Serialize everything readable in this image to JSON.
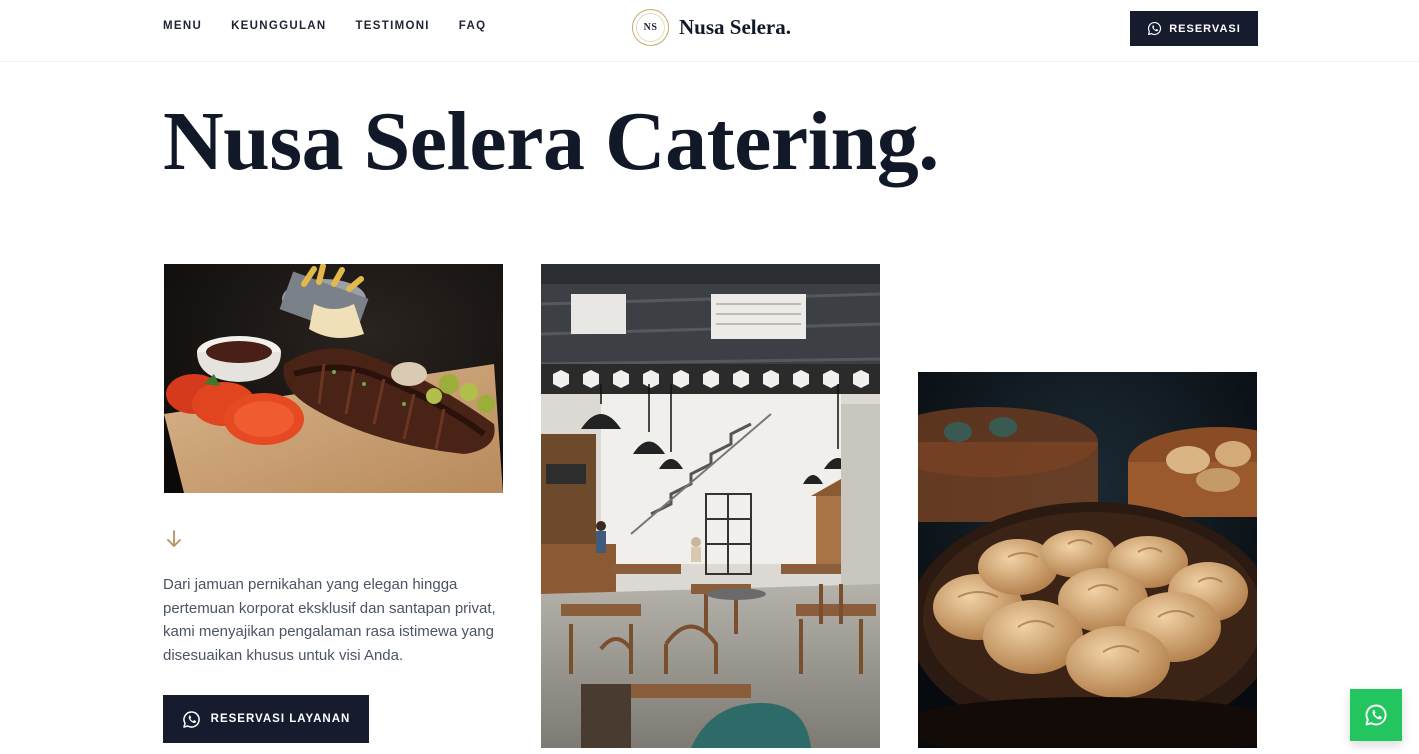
{
  "nav": {
    "items": [
      "MENU",
      "KEUNGGULAN",
      "TESTIMONI",
      "FAQ"
    ]
  },
  "brand": {
    "logo_text": "NS",
    "name": "Nusa Selera."
  },
  "header": {
    "reserve_label": "RESERVASI"
  },
  "hero": {
    "title": "Nusa Selera Catering.",
    "description": "Dari jamuan pernikahan yang elegan hingga pertemuan korporat eksklusif dan santapan privat, kami menyajikan pengalaman rasa istimewa yang disesuaikan khusus untuk visi Anda.",
    "cta_label": "RESERVASI LAYANAN"
  },
  "icons": {
    "whatsapp": "whatsapp-icon",
    "arrow": "arrow-down-icon"
  },
  "colors": {
    "primary_dark": "#161b2e",
    "accent_gold": "#c8a86a",
    "whatsapp_green": "#22c55e",
    "text_body": "#4b5563"
  }
}
